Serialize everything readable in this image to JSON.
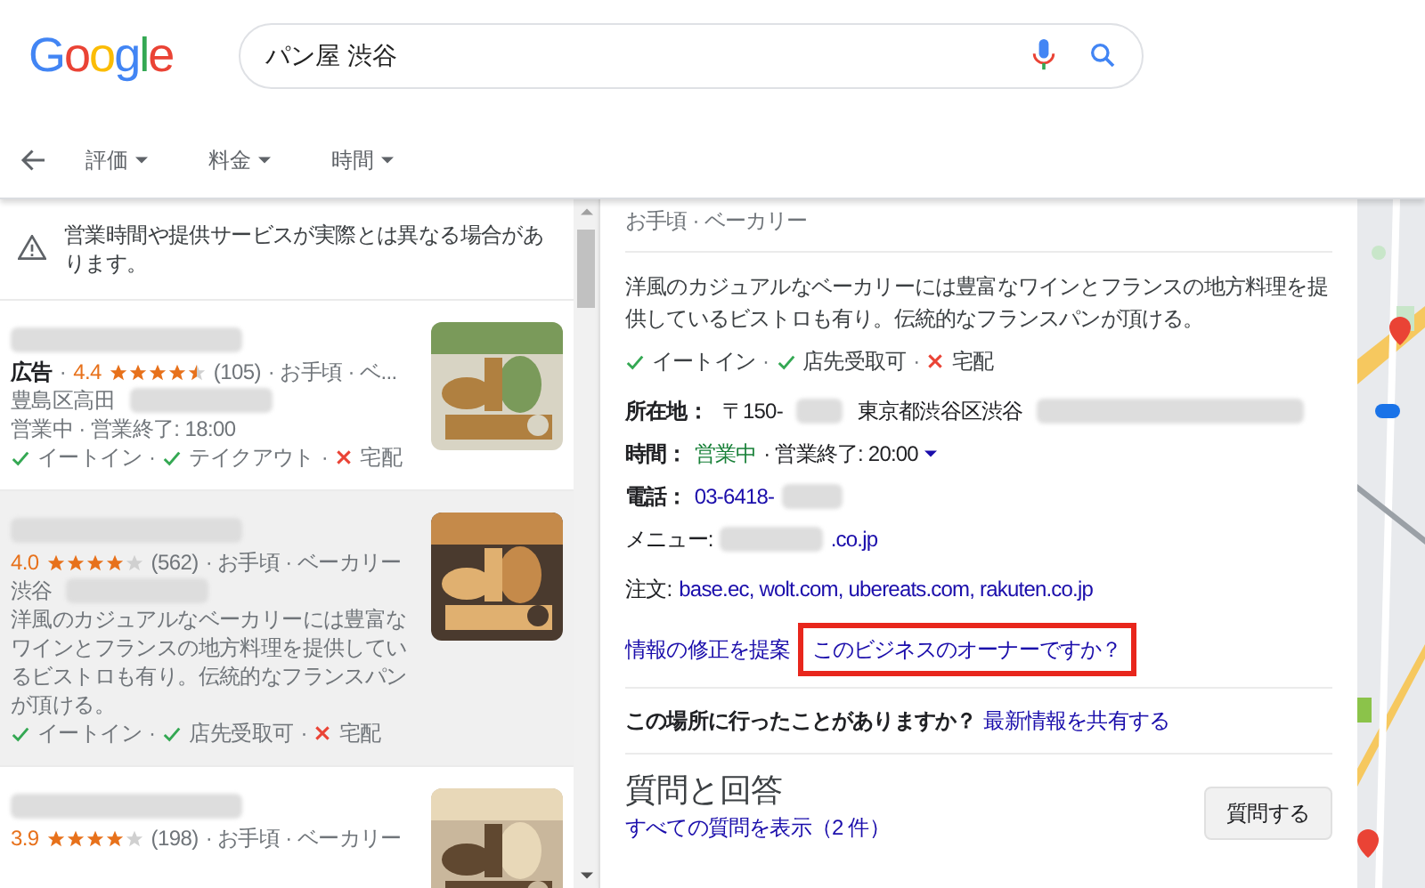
{
  "logo": "Google",
  "separator": "·",
  "search": {
    "value": "パン屋 渋谷"
  },
  "filters": [
    {
      "label": "評価"
    },
    {
      "label": "料金"
    },
    {
      "label": "時間"
    }
  ],
  "notice": "営業時間や提供サービスが実際とは異なる場合があります。",
  "listings": [
    {
      "selected": false,
      "ad": "広告",
      "rating": "4.4",
      "stars": 4.5,
      "reviews": "(105)",
      "category": "· お手頃 · ベ...",
      "address": "豊島区高田",
      "hours": "営業中 · 営業終了: 18:00",
      "amenities": [
        {
          "label": "イートイン",
          "available": true
        },
        {
          "label": "テイクアウト",
          "available": true
        },
        {
          "label": "宅配",
          "available": false
        }
      ]
    },
    {
      "selected": true,
      "rating": "4.0",
      "stars": 4,
      "reviews": "(562)",
      "category": "· お手頃 · ベーカリー",
      "address": "渋谷",
      "description": "洋風のカジュアルなベーカリーには豊富なワインとフランスの地方料理を提供しているビストロも有り。伝統的なフランスパンが頂ける。",
      "amenities": [
        {
          "label": "イートイン",
          "available": true
        },
        {
          "label": "店先受取可",
          "available": true
        },
        {
          "label": "宅配",
          "available": false
        }
      ]
    },
    {
      "selected": false,
      "rating": "3.9",
      "stars": 4,
      "reviews": "(198)",
      "category": "· お手頃 · ベーカリー"
    }
  ],
  "detail": {
    "category": "お手頃 · ベーカリー",
    "description": "洋風のカジュアルなベーカリーには豊富なワインとフランスの地方料理を提供しているビストロも有り。伝統的なフランスパンが頂ける。",
    "amenities": [
      {
        "label": "イートイン",
        "available": true
      },
      {
        "label": "店先受取可",
        "available": true
      },
      {
        "label": "宅配",
        "available": false
      }
    ],
    "address": {
      "label": "所在地：",
      "postal": "〒150-",
      "value": "東京都渋谷区渋谷"
    },
    "hours": {
      "label": "時間：",
      "status": "営業中",
      "value": "· 営業終了: 20:00"
    },
    "phone": {
      "label": "電話：",
      "value": "03-6418-"
    },
    "menu": {
      "label": "メニュー:",
      "value": ".co.jp"
    },
    "order": {
      "label": "注文:",
      "value": "base.ec, wolt.com, ubereats.com, rakuten.co.jp"
    },
    "suggest_edit": "情報の修正を提案",
    "owner_link": {
      "label": "このビジネスのオーナーですか？",
      "highlighted": true
    },
    "visited": {
      "question": "この場所に行ったことがありますか？",
      "link": "最新情報を共有する"
    },
    "qa": {
      "title": "質問と回答",
      "all_link": "すべての質問を表示（2 件）",
      "ask_button": "質問する"
    }
  }
}
